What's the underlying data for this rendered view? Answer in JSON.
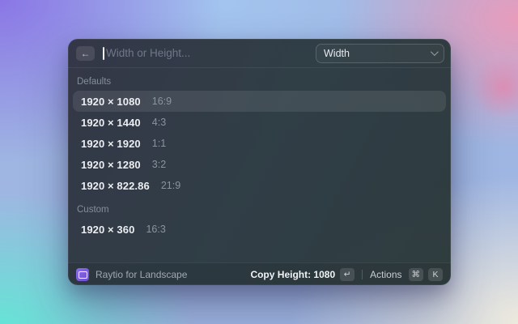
{
  "window": {
    "search": {
      "back_icon": "←",
      "placeholder": "Width or Height...",
      "dropdown_value": "Width"
    },
    "sections": [
      {
        "label": "Defaults",
        "items": [
          {
            "size": "1920 × 1080",
            "ratio": "16:9",
            "selected": true
          },
          {
            "size": "1920 × 1440",
            "ratio": "4:3",
            "selected": false
          },
          {
            "size": "1920 × 1920",
            "ratio": "1:1",
            "selected": false
          },
          {
            "size": "1920 × 1280",
            "ratio": "3:2",
            "selected": false
          },
          {
            "size": "1920 × 822.86",
            "ratio": "21:9",
            "selected": false
          }
        ]
      },
      {
        "label": "Custom",
        "items": [
          {
            "size": "1920 × 360",
            "ratio": "16:3",
            "selected": false
          }
        ]
      }
    ],
    "footer": {
      "app_name": "Raytio for Landscape",
      "primary_action": "Copy Height: 1080",
      "enter_key": "↵",
      "actions_label": "Actions",
      "cmd_key": "⌘",
      "k_key": "K"
    }
  },
  "colors": {
    "accent_purple": "#7c5cd6",
    "panel_dark": "#2b3740",
    "selection": "rgba(255,255,255,0.09)",
    "wallpaper_purple": "#8a75e6",
    "wallpaper_blue": "#a3c6f0",
    "wallpaper_pink": "#ec9ab9",
    "wallpaper_teal": "#61e7d4",
    "wallpaper_cream": "#f3eddd"
  }
}
